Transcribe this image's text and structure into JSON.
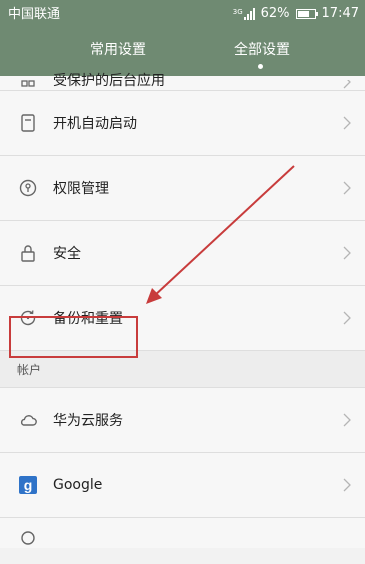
{
  "status_bar": {
    "carrier": "中国联通",
    "network": "3G",
    "battery": "62%",
    "battery_level": 0.62,
    "time": "17:47"
  },
  "tabs": [
    {
      "label": "常用设置",
      "selected": false
    },
    {
      "label": "全部设置",
      "selected": true
    }
  ],
  "rows": [
    {
      "label": "受保护的后台应用",
      "icon": "protected-apps-icon"
    },
    {
      "label": "开机自动启动",
      "icon": "autostart-icon"
    },
    {
      "label": "权限管理",
      "icon": "permission-icon"
    },
    {
      "label": "安全",
      "icon": "lock-icon"
    },
    {
      "label": "备份和重置",
      "icon": "backup-icon"
    }
  ],
  "section": {
    "label": "帐户"
  },
  "account_rows": [
    {
      "label": "华为云服务",
      "icon": "cloud-icon"
    },
    {
      "label": "Google",
      "icon": "google-icon"
    }
  ],
  "colors": {
    "header": "#6f8a72",
    "highlight": "#c83c3c",
    "background": "#f7f7f7"
  }
}
